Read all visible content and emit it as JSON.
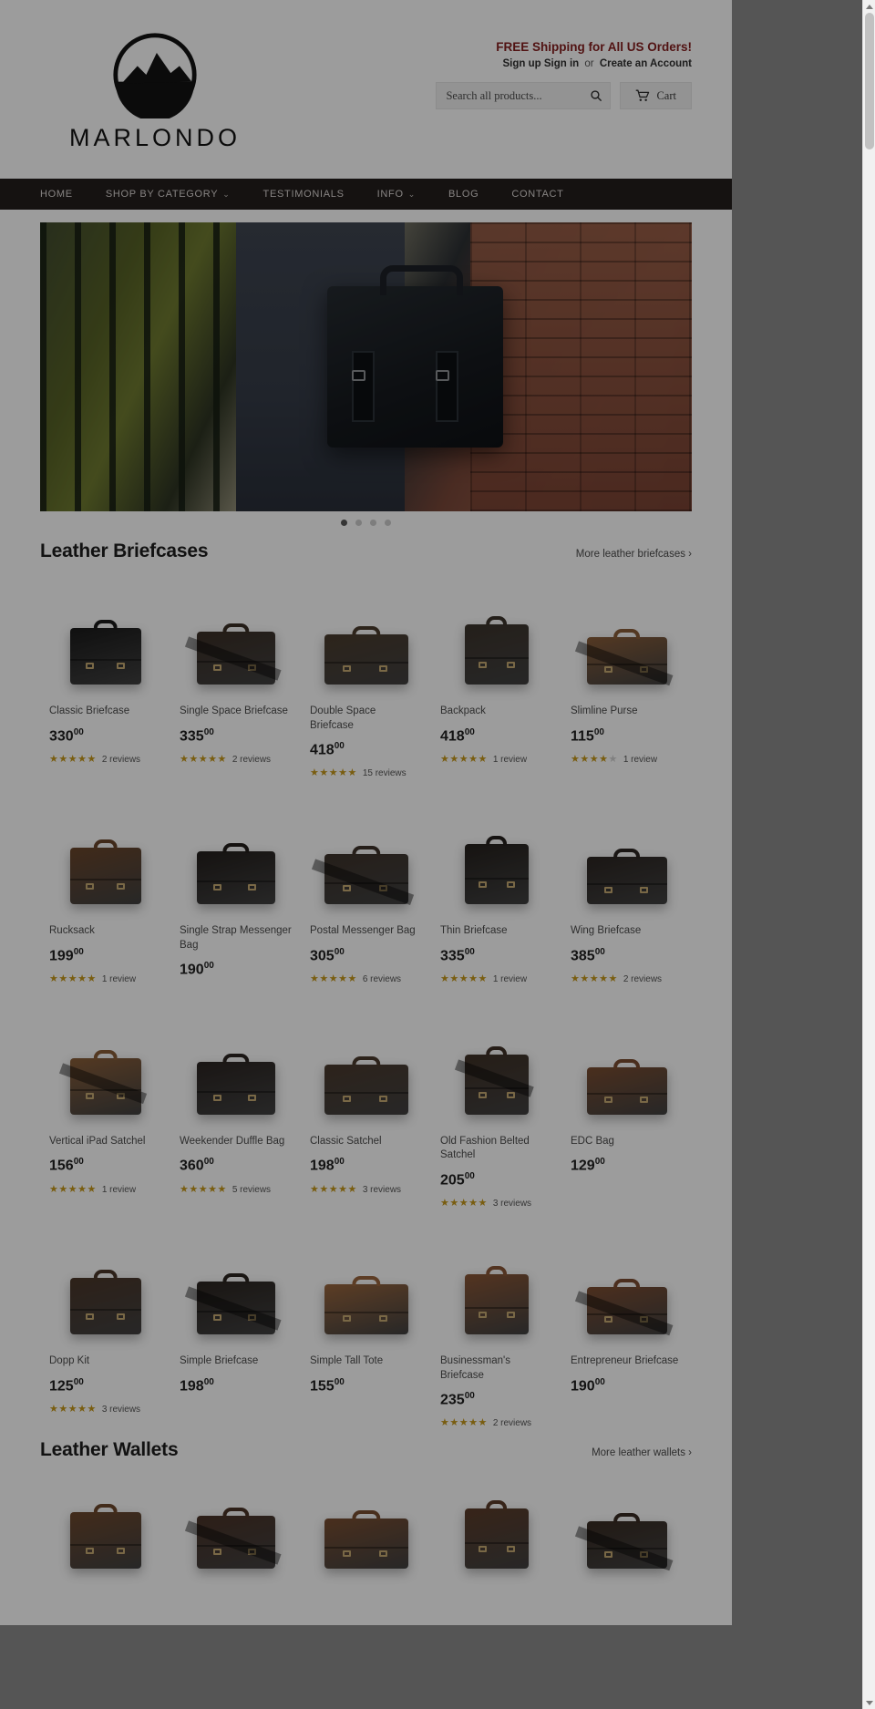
{
  "brand": {
    "name": "MARLONDO",
    "logo_icon": "mountain-circle-logo"
  },
  "promo": {
    "shipping_text": "FREE Shipping for All US Orders!",
    "signup_label": "Sign up",
    "signin_label": "Sign in",
    "or_label": "or",
    "create_account_label": "Create an Account"
  },
  "search": {
    "placeholder": "Search all products...",
    "value": "",
    "icon": "search-icon"
  },
  "cart": {
    "label": "Cart",
    "icon": "cart-icon"
  },
  "nav": [
    {
      "label": "HOME",
      "caret": false
    },
    {
      "label": "SHOP BY CATEGORY",
      "caret": true
    },
    {
      "label": "TESTIMONIALS",
      "caret": false
    },
    {
      "label": "INFO",
      "caret": true
    },
    {
      "label": "BLOG",
      "caret": false
    },
    {
      "label": "CONTACT",
      "caret": false
    }
  ],
  "hero": {
    "alt": "man holding black leather briefcase by iron fence and brick wall",
    "slides": 4,
    "active_slide": 1
  },
  "sections": [
    {
      "title": "Leather Briefcases",
      "more_label": "More leather briefcases ›",
      "products": [
        {
          "name": "Classic Briefcase",
          "price": "330",
          "cents": "00",
          "stars": 5,
          "reviews": "2 reviews",
          "color": "#191919"
        },
        {
          "name": "Single Space Briefcase",
          "price": "335",
          "cents": "00",
          "stars": 5,
          "reviews": "2 reviews",
          "color": "#3a2d23"
        },
        {
          "name": "Double Space Briefcase",
          "price": "418",
          "cents": "00",
          "stars": 5,
          "reviews": "15 reviews",
          "color": "#4a3a2a"
        },
        {
          "name": "Backpack",
          "price": "418",
          "cents": "00",
          "stars": 5,
          "reviews": "1 review",
          "color": "#3b3229"
        },
        {
          "name": "Slimline Purse",
          "price": "115",
          "cents": "00",
          "stars": 4,
          "reviews": "1 review",
          "color": "#8a5a33"
        },
        {
          "name": "Rucksack",
          "price": "199",
          "cents": "00",
          "stars": 5,
          "reviews": "1 review",
          "color": "#6b4326"
        },
        {
          "name": "Single Strap Messenger Bag",
          "price": "190",
          "cents": "00",
          "stars": 0,
          "reviews": "",
          "color": "#221d1a"
        },
        {
          "name": "Postal Messenger Bag",
          "price": "305",
          "cents": "00",
          "stars": 5,
          "reviews": "6 reviews",
          "color": "#3d3128"
        },
        {
          "name": "Thin Briefcase",
          "price": "335",
          "cents": "00",
          "stars": 5,
          "reviews": "1 review",
          "color": "#241f1b"
        },
        {
          "name": "Wing Briefcase",
          "price": "385",
          "cents": "00",
          "stars": 5,
          "reviews": "2 reviews",
          "color": "#2b2420"
        },
        {
          "name": "Vertical iPad Satchel",
          "price": "156",
          "cents": "00",
          "stars": 5,
          "reviews": "1 review",
          "color": "#8b5b32"
        },
        {
          "name": "Weekender Duffle Bag",
          "price": "360",
          "cents": "00",
          "stars": 5,
          "reviews": "5 reviews",
          "color": "#2a2320"
        },
        {
          "name": "Classic Satchel",
          "price": "198",
          "cents": "00",
          "stars": 5,
          "reviews": "3 reviews",
          "color": "#4a382a"
        },
        {
          "name": "Old Fashion Belted Satchel",
          "price": "205",
          "cents": "00",
          "stars": 5,
          "reviews": "3 reviews",
          "color": "#3f2f23"
        },
        {
          "name": "EDC Bag",
          "price": "129",
          "cents": "00",
          "stars": 0,
          "reviews": "",
          "color": "#7b4a2b"
        },
        {
          "name": "Dopp Kit",
          "price": "125",
          "cents": "00",
          "stars": 5,
          "reviews": "3 reviews",
          "color": "#4b3526"
        },
        {
          "name": "Simple Briefcase",
          "price": "198",
          "cents": "00",
          "stars": 0,
          "reviews": "",
          "color": "#2a231e"
        },
        {
          "name": "Simple Tall Tote",
          "price": "155",
          "cents": "00",
          "stars": 0,
          "reviews": "",
          "color": "#9a6236"
        },
        {
          "name": "Businessman's Briefcase",
          "price": "235",
          "cents": "00",
          "stars": 5,
          "reviews": "2 reviews",
          "color": "#8b5330"
        },
        {
          "name": "Entrepreneur Briefcase",
          "price": "190",
          "cents": "00",
          "stars": 0,
          "reviews": "",
          "color": "#7e4a2c"
        }
      ]
    },
    {
      "title": "Leather Wallets",
      "more_label": "More leather wallets ›",
      "products": [
        {
          "name": "",
          "price": "",
          "cents": "",
          "stars": 0,
          "reviews": "",
          "color": "#6e4527"
        },
        {
          "name": "",
          "price": "",
          "cents": "",
          "stars": 0,
          "reviews": "",
          "color": "#4a3124"
        },
        {
          "name": "",
          "price": "",
          "cents": "",
          "stars": 0,
          "reviews": "",
          "color": "#7a4b2b"
        },
        {
          "name": "",
          "price": "",
          "cents": "",
          "stars": 0,
          "reviews": "",
          "color": "#5c3a25"
        },
        {
          "name": "",
          "price": "",
          "cents": "",
          "stars": 0,
          "reviews": "",
          "color": "#382a20"
        }
      ]
    }
  ]
}
